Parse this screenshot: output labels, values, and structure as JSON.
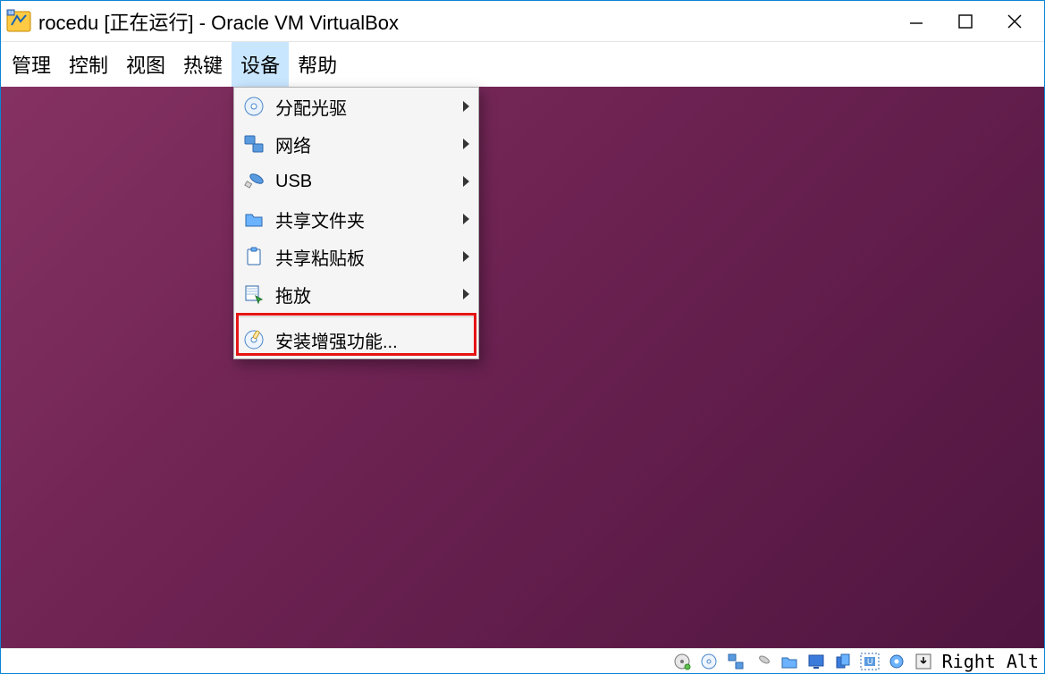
{
  "titlebar": {
    "title": "rocedu [正在运行] - Oracle VM VirtualBox"
  },
  "menubar": {
    "items": [
      "管理",
      "控制",
      "视图",
      "热键",
      "设备",
      "帮助"
    ],
    "open_index": 4
  },
  "devices_menu": {
    "items": [
      {
        "label": "分配光驱",
        "icon": "optical-drive-icon",
        "submenu": true
      },
      {
        "label": "网络",
        "icon": "network-icon",
        "submenu": true
      },
      {
        "label": "USB",
        "icon": "usb-icon",
        "submenu": true
      },
      {
        "label": "共享文件夹",
        "icon": "shared-folder-icon",
        "submenu": true
      },
      {
        "label": "共享粘贴板",
        "icon": "clipboard-icon",
        "submenu": true
      },
      {
        "label": "拖放",
        "icon": "drag-drop-icon",
        "submenu": true
      },
      {
        "label": "安装增强功能...",
        "icon": "guest-additions-icon",
        "submenu": false,
        "highlighted": true
      }
    ]
  },
  "statusbar": {
    "icons": [
      "hard-disk-icon",
      "optical-disc-icon",
      "network-indicator-icon",
      "usb-indicator-icon",
      "folder-indicator-icon",
      "display-capture-icon",
      "clipboard-indicator-icon",
      "unity-icon",
      "settings-gear-icon",
      "download-icon"
    ],
    "hostkey": "Right Alt"
  }
}
